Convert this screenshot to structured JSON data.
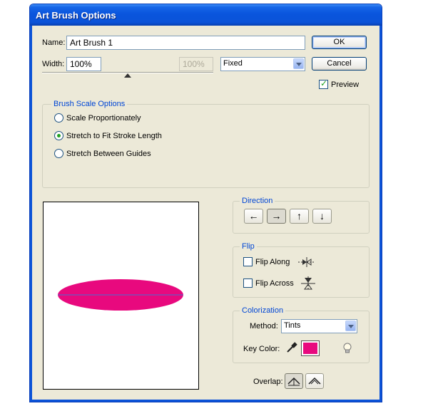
{
  "window": {
    "title": "Art Brush Options"
  },
  "name_field": {
    "label": "Name:",
    "value": "Art Brush 1"
  },
  "width_field": {
    "label": "Width:",
    "value": "100%",
    "disabled_value": "100%",
    "slider_value_percent": 100
  },
  "width_mode": {
    "selected": "Fixed"
  },
  "buttons": {
    "ok": "OK",
    "cancel": "Cancel"
  },
  "preview": {
    "label": "Preview",
    "checked": true
  },
  "brush_scale": {
    "title": "Brush Scale Options",
    "options": [
      {
        "label": "Scale Proportionately",
        "selected": false
      },
      {
        "label": "Stretch to Fit Stroke Length",
        "selected": true
      },
      {
        "label": "Stretch Between Guides",
        "selected": false
      }
    ]
  },
  "preview_shape": {
    "fill_color": "#e8097e",
    "line_color": "#4a6ad0"
  },
  "direction": {
    "title": "Direction",
    "buttons": [
      {
        "glyph": "←",
        "selected": false
      },
      {
        "glyph": "→",
        "selected": true
      },
      {
        "glyph": "↑",
        "selected": false
      },
      {
        "glyph": "↓",
        "selected": false
      }
    ]
  },
  "flip": {
    "title": "Flip",
    "along": {
      "label": "Flip Along",
      "checked": false
    },
    "across": {
      "label": "Flip Across",
      "checked": false
    }
  },
  "colorization": {
    "title": "Colorization",
    "method_label": "Method:",
    "method_value": "Tints",
    "key_color_label": "Key Color:",
    "key_color": "#e8097e"
  },
  "overlap": {
    "label": "Overlap:"
  }
}
